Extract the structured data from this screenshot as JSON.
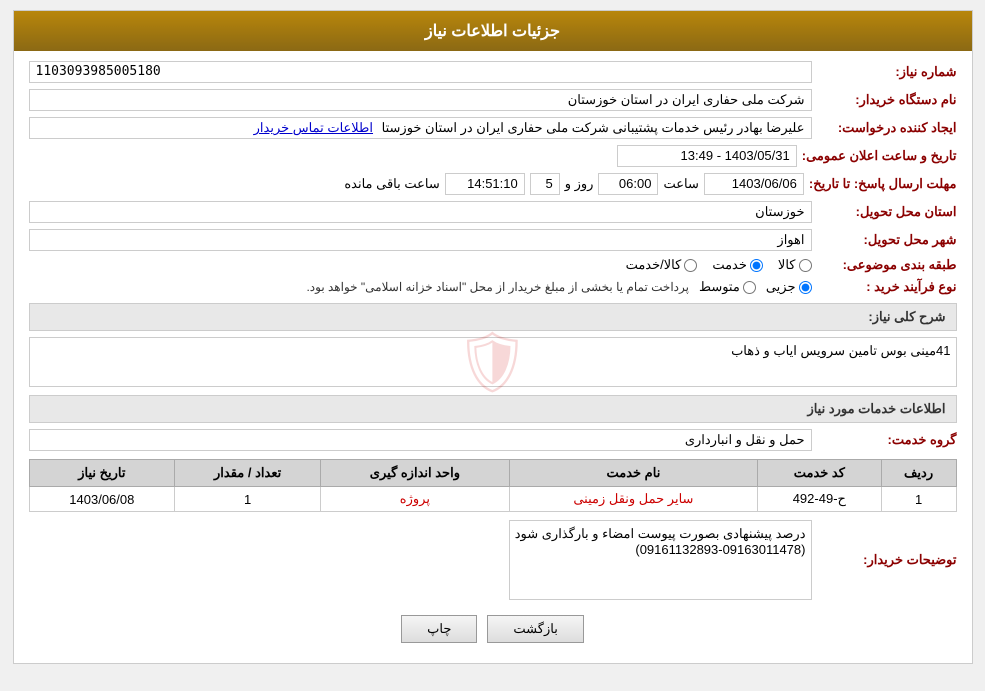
{
  "page": {
    "title": "جزئیات اطلاعات نیاز"
  },
  "fields": {
    "request_number_label": "شماره نیاز:",
    "request_number_value": "1103093985005180",
    "buyer_org_label": "نام دستگاه خریدار:",
    "buyer_org_value": "شرکت ملی حفاری ایران در استان خوزستان",
    "creator_label": "ایجاد کننده درخواست:",
    "creator_value": "علیرضا بهادر رئیس خدمات پشتیبانی شرکت ملی حفاری ایران در استان خوزستا",
    "creator_link": "اطلاعات تماس خریدار",
    "announce_datetime_label": "تاریخ و ساعت اعلان عمومی:",
    "announce_datetime_value": "1403/05/31 - 13:49",
    "response_deadline_label": "مهلت ارسال پاسخ: تا تاریخ:",
    "response_date": "1403/06/06",
    "response_time_label": "ساعت",
    "response_time": "06:00",
    "response_days_label": "روز و",
    "response_days": "5",
    "response_remaining_label": "ساعت باقی مانده",
    "response_remaining": "14:51:10",
    "province_label": "استان محل تحویل:",
    "province_value": "خوزستان",
    "city_label": "شهر محل تحویل:",
    "city_value": "اهواز",
    "category_label": "طبقه بندی موضوعی:",
    "category_options": [
      {
        "label": "کالا",
        "value": "kala"
      },
      {
        "label": "خدمت",
        "value": "khedmat"
      },
      {
        "label": "کالا/خدمت",
        "value": "kala_khedmat"
      }
    ],
    "category_selected": "khedmat",
    "purchase_type_label": "نوع فرآیند خرید :",
    "purchase_type_options": [
      {
        "label": "جزیی",
        "value": "jozii"
      },
      {
        "label": "متوسط",
        "value": "motavaset"
      }
    ],
    "purchase_type_selected": "jozii",
    "purchase_type_note": "پرداخت تمام یا بخشی از مبلغ خریدار از محل \"اسناد خزانه اسلامی\" خواهد بود.",
    "need_description_label": "شرح کلی نیاز:",
    "need_description_value": "41مینی بوس تامین سرویس ایاب و ذهاب",
    "services_section_label": "اطلاعات خدمات مورد نیاز",
    "service_group_label": "گروه خدمت:",
    "service_group_value": "حمل و نقل و انبارداری",
    "table": {
      "headers": [
        "ردیف",
        "کد خدمت",
        "نام خدمت",
        "واحد اندازه گیری",
        "تعداد / مقدار",
        "تاریخ نیاز"
      ],
      "rows": [
        {
          "row_num": "1",
          "service_code": "ح-49-492",
          "service_name": "سایر حمل ونقل زمینی",
          "unit": "پروژه",
          "quantity": "1",
          "date": "1403/06/08"
        }
      ]
    },
    "buyer_notes_label": "توضیحات خریدار:",
    "buyer_notes_value": "درصد پیشنهادی بصورت پیوست امضاء و بارگذاری شود\n(09161132893-09163011478)",
    "back_button": "بازگشت",
    "print_button": "چاپ"
  }
}
